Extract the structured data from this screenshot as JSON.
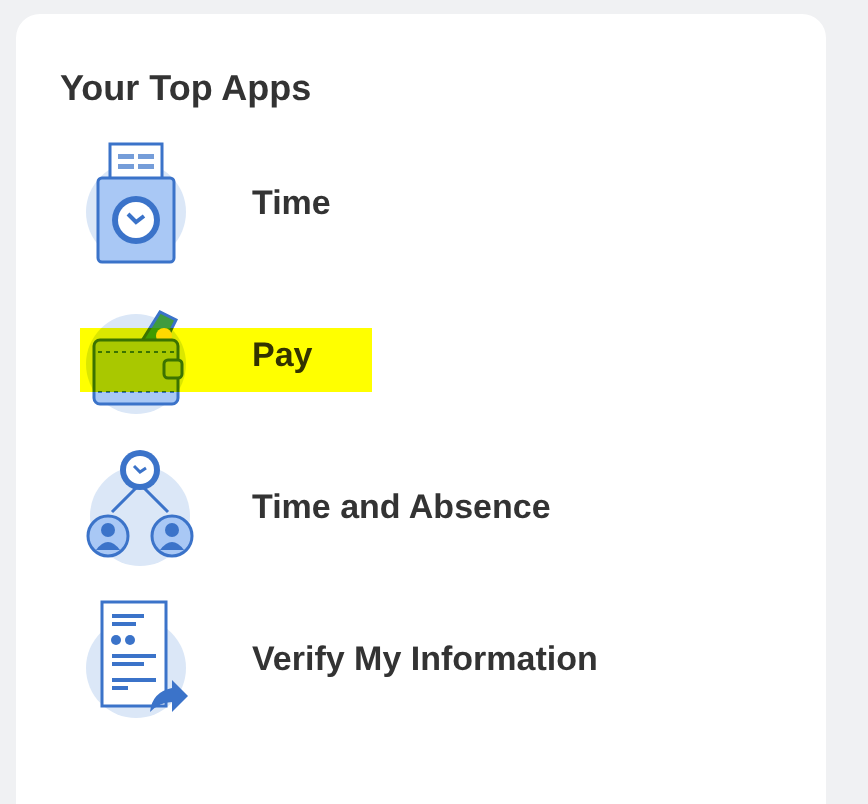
{
  "card": {
    "title": "Your Top Apps"
  },
  "apps": [
    {
      "kind": "time",
      "label": "Time",
      "highlighted": false
    },
    {
      "kind": "pay",
      "label": "Pay",
      "highlighted": true
    },
    {
      "kind": "absence",
      "label": "Time and Absence",
      "highlighted": false
    },
    {
      "kind": "info",
      "label": "Verify My Information",
      "highlighted": false
    }
  ]
}
